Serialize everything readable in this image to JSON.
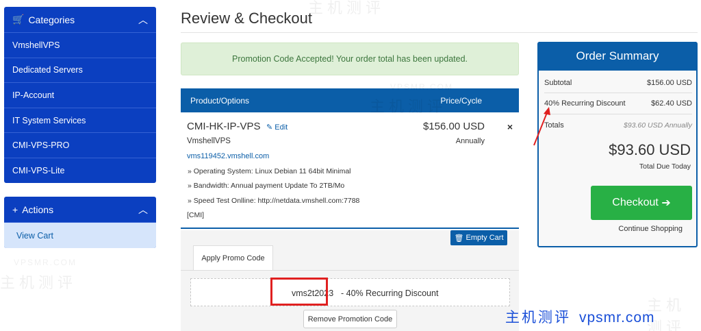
{
  "sidebar": {
    "categories_title": "Categories",
    "categories": [
      "VmshellVPS",
      "Dedicated Servers",
      "IP-Account",
      "IT System Services",
      "CMI-VPS-PRO",
      "CMI-VPS-Lite"
    ],
    "actions_title": "Actions",
    "actions": [
      "View Cart"
    ]
  },
  "main": {
    "title": "Review & Checkout",
    "alert": "Promotion Code Accepted! Your order total has been updated."
  },
  "cart": {
    "col_product": "Product/Options",
    "col_price": "Price/Cycle",
    "item": {
      "name": "CMI-HK-IP-VPS",
      "edit_label": "Edit",
      "group": "VmshellVPS",
      "domain": "vms119452.vmshell.com",
      "options": [
        "» Operating System: Linux Debian 11 64bit Minimal",
        "» Bandwidth: Annual payment Update To 2TB/Mo",
        "» Speed Test Onlline: http://netdata.vmshell.com:7788"
      ],
      "tag": "[CMI]",
      "price": "$156.00 USD",
      "cycle": "Annually",
      "remove_symbol": "×"
    },
    "empty_cart_label": "Empty Cart"
  },
  "promo": {
    "tab_label": "Apply Promo Code",
    "code": "vms2t2023",
    "description": "- 40% Recurring Discount",
    "remove_label": "Remove Promotion Code"
  },
  "summary": {
    "title": "Order Summary",
    "subtotal_label": "Subtotal",
    "subtotal_value": "$156.00 USD",
    "discount_label": "40% Recurring Discount",
    "discount_value": "$62.40 USD",
    "totals_label": "Totals",
    "totals_value": "$93.60 USD Annually",
    "total_big": "$93.60 USD",
    "total_due_label": "Total Due Today",
    "checkout_label": "Checkout",
    "continue_label": "Continue Shopping"
  },
  "watermark": {
    "cn": "主机测评",
    "domain": "vpsmr.com",
    "small": "VPSMR.COM"
  },
  "colors": {
    "sidebar": "#0b3fc0",
    "primary": "#0b5ea8",
    "success": "#28b045",
    "alert_bg": "#dff0d8",
    "annotation": "#e02020"
  }
}
